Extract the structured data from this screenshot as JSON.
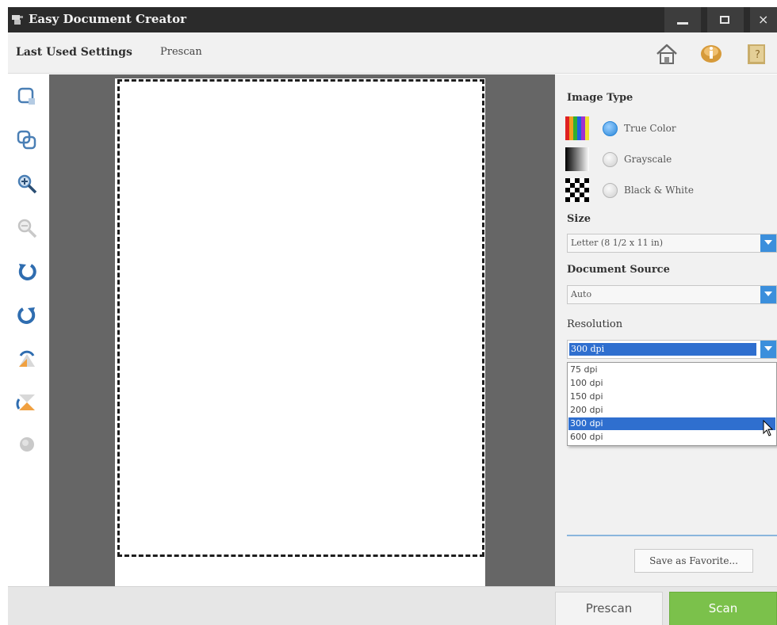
{
  "window": {
    "title": "Easy Document Creator",
    "close_glyph": "×"
  },
  "menu": {
    "last_used_settings": "Last Used Settings",
    "prescan": "Prescan"
  },
  "top_icons": [
    "home-icon",
    "info-icon",
    "help-book-icon"
  ],
  "tools": [
    "select-area-icon",
    "multi-select-icon",
    "zoom-in-icon",
    "zoom-out-icon",
    "rotate-left-icon",
    "rotate-right-icon",
    "flip-vertical-icon",
    "flip-horizontal-icon",
    "reset-icon"
  ],
  "panel": {
    "image_type_label": "Image Type",
    "image_types": [
      {
        "label": "True Color",
        "selected": true
      },
      {
        "label": "Grayscale",
        "selected": false
      },
      {
        "label": "Black & White",
        "selected": false
      }
    ],
    "size_label": "Size",
    "size_value": "Letter (8 1/2 x 11 in)",
    "source_label": "Document Source",
    "source_value": "Auto",
    "resolution_label": "Resolution",
    "resolution_value": "300 dpi",
    "resolution_options": [
      "75 dpi",
      "100 dpi",
      "150 dpi",
      "200 dpi",
      "300 dpi",
      "600 dpi"
    ],
    "resolution_selected_index": 4,
    "save_favorite": "Save as Favorite..."
  },
  "buttons": {
    "prescan": "Prescan",
    "scan": "Scan"
  },
  "colors": {
    "accent_blue": "#2f6fcf",
    "scan_green": "#7bc14b",
    "preview_gray": "#666666"
  }
}
